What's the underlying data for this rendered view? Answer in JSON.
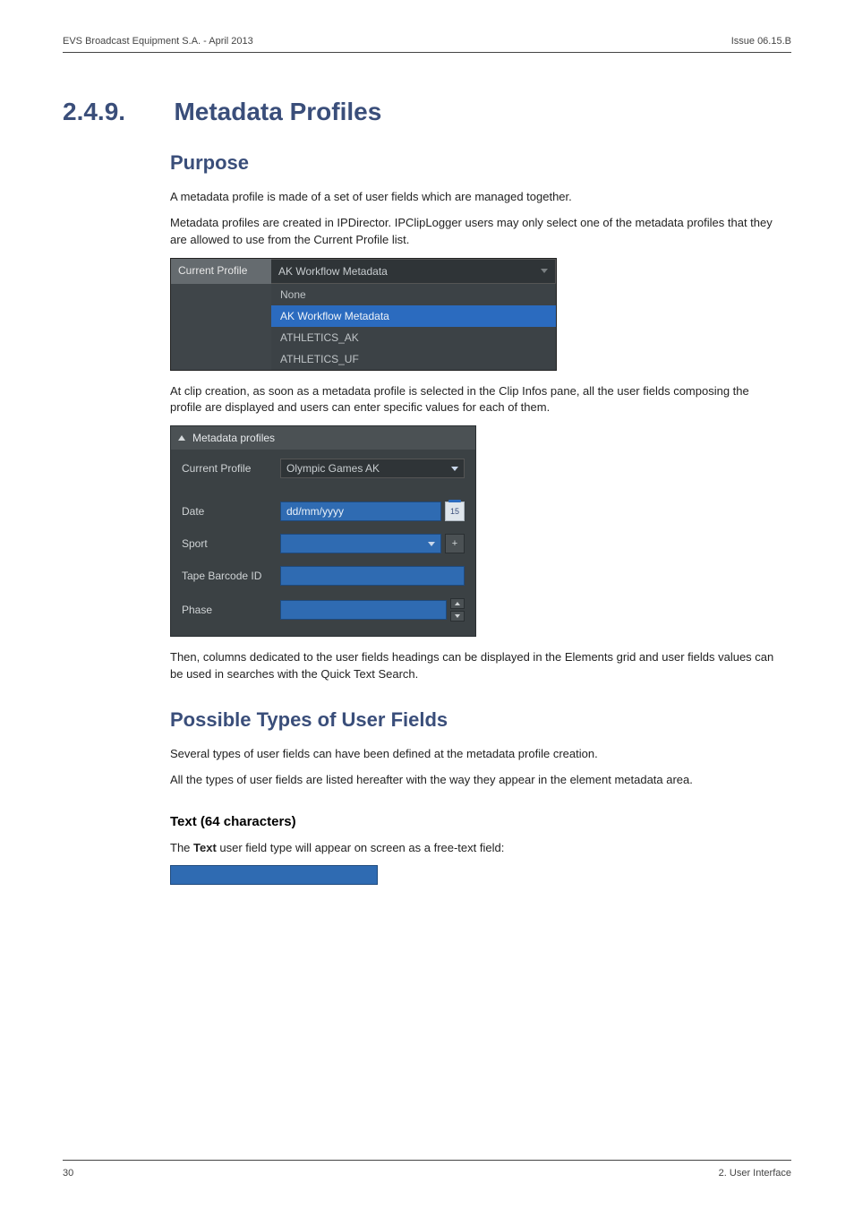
{
  "header": {
    "left": "EVS Broadcast Equipment S.A.  - April 2013",
    "right": "Issue 06.15.B"
  },
  "section": {
    "number": "2.4.9.",
    "title": "Metadata Profiles"
  },
  "purpose": {
    "heading": "Purpose",
    "p1": "A metadata profile is made of a set of user fields which are managed together.",
    "p2": "Metadata profiles are created in IPDirector. IPClipLogger users may only select one of the metadata profiles that they are allowed to use from the Current Profile list."
  },
  "shot1": {
    "label": "Current Profile",
    "selected": "AK Workflow Metadata",
    "options": [
      "None",
      "AK Workflow Metadata",
      "ATHLETICS_AK",
      "ATHLETICS_UF"
    ]
  },
  "afterShot1": "At clip creation, as soon as a metadata profile is selected in the Clip Infos pane, all the user fields composing the profile are displayed and users can enter specific values for each of them.",
  "shot2": {
    "panelTitle": "Metadata profiles",
    "currentProfileLabel": "Current Profile",
    "currentProfileValue": "Olympic Games AK",
    "rows": {
      "date": {
        "label": "Date",
        "placeholder": "dd/mm/yyyy",
        "cal": "15"
      },
      "sport": {
        "label": "Sport",
        "plus": "+"
      },
      "tape": {
        "label": "Tape Barcode ID"
      },
      "phase": {
        "label": "Phase"
      }
    }
  },
  "afterShot2": "Then, columns dedicated to the user fields headings can be displayed in the Elements grid and user fields values can be used in searches with the Quick Text Search.",
  "types": {
    "heading": "Possible Types of User Fields",
    "p1": "Several types of user fields can have been defined at the metadata profile creation.",
    "p2": "All the types of user fields are listed hereafter with the way they appear in the element metadata area.",
    "text64": {
      "heading": "Text (64 characters)",
      "line_pre": "The ",
      "line_bold": "Text",
      "line_post": " user field type will appear on screen as a free-text field:"
    }
  },
  "footer": {
    "left": "30",
    "right": "2. User Interface"
  }
}
